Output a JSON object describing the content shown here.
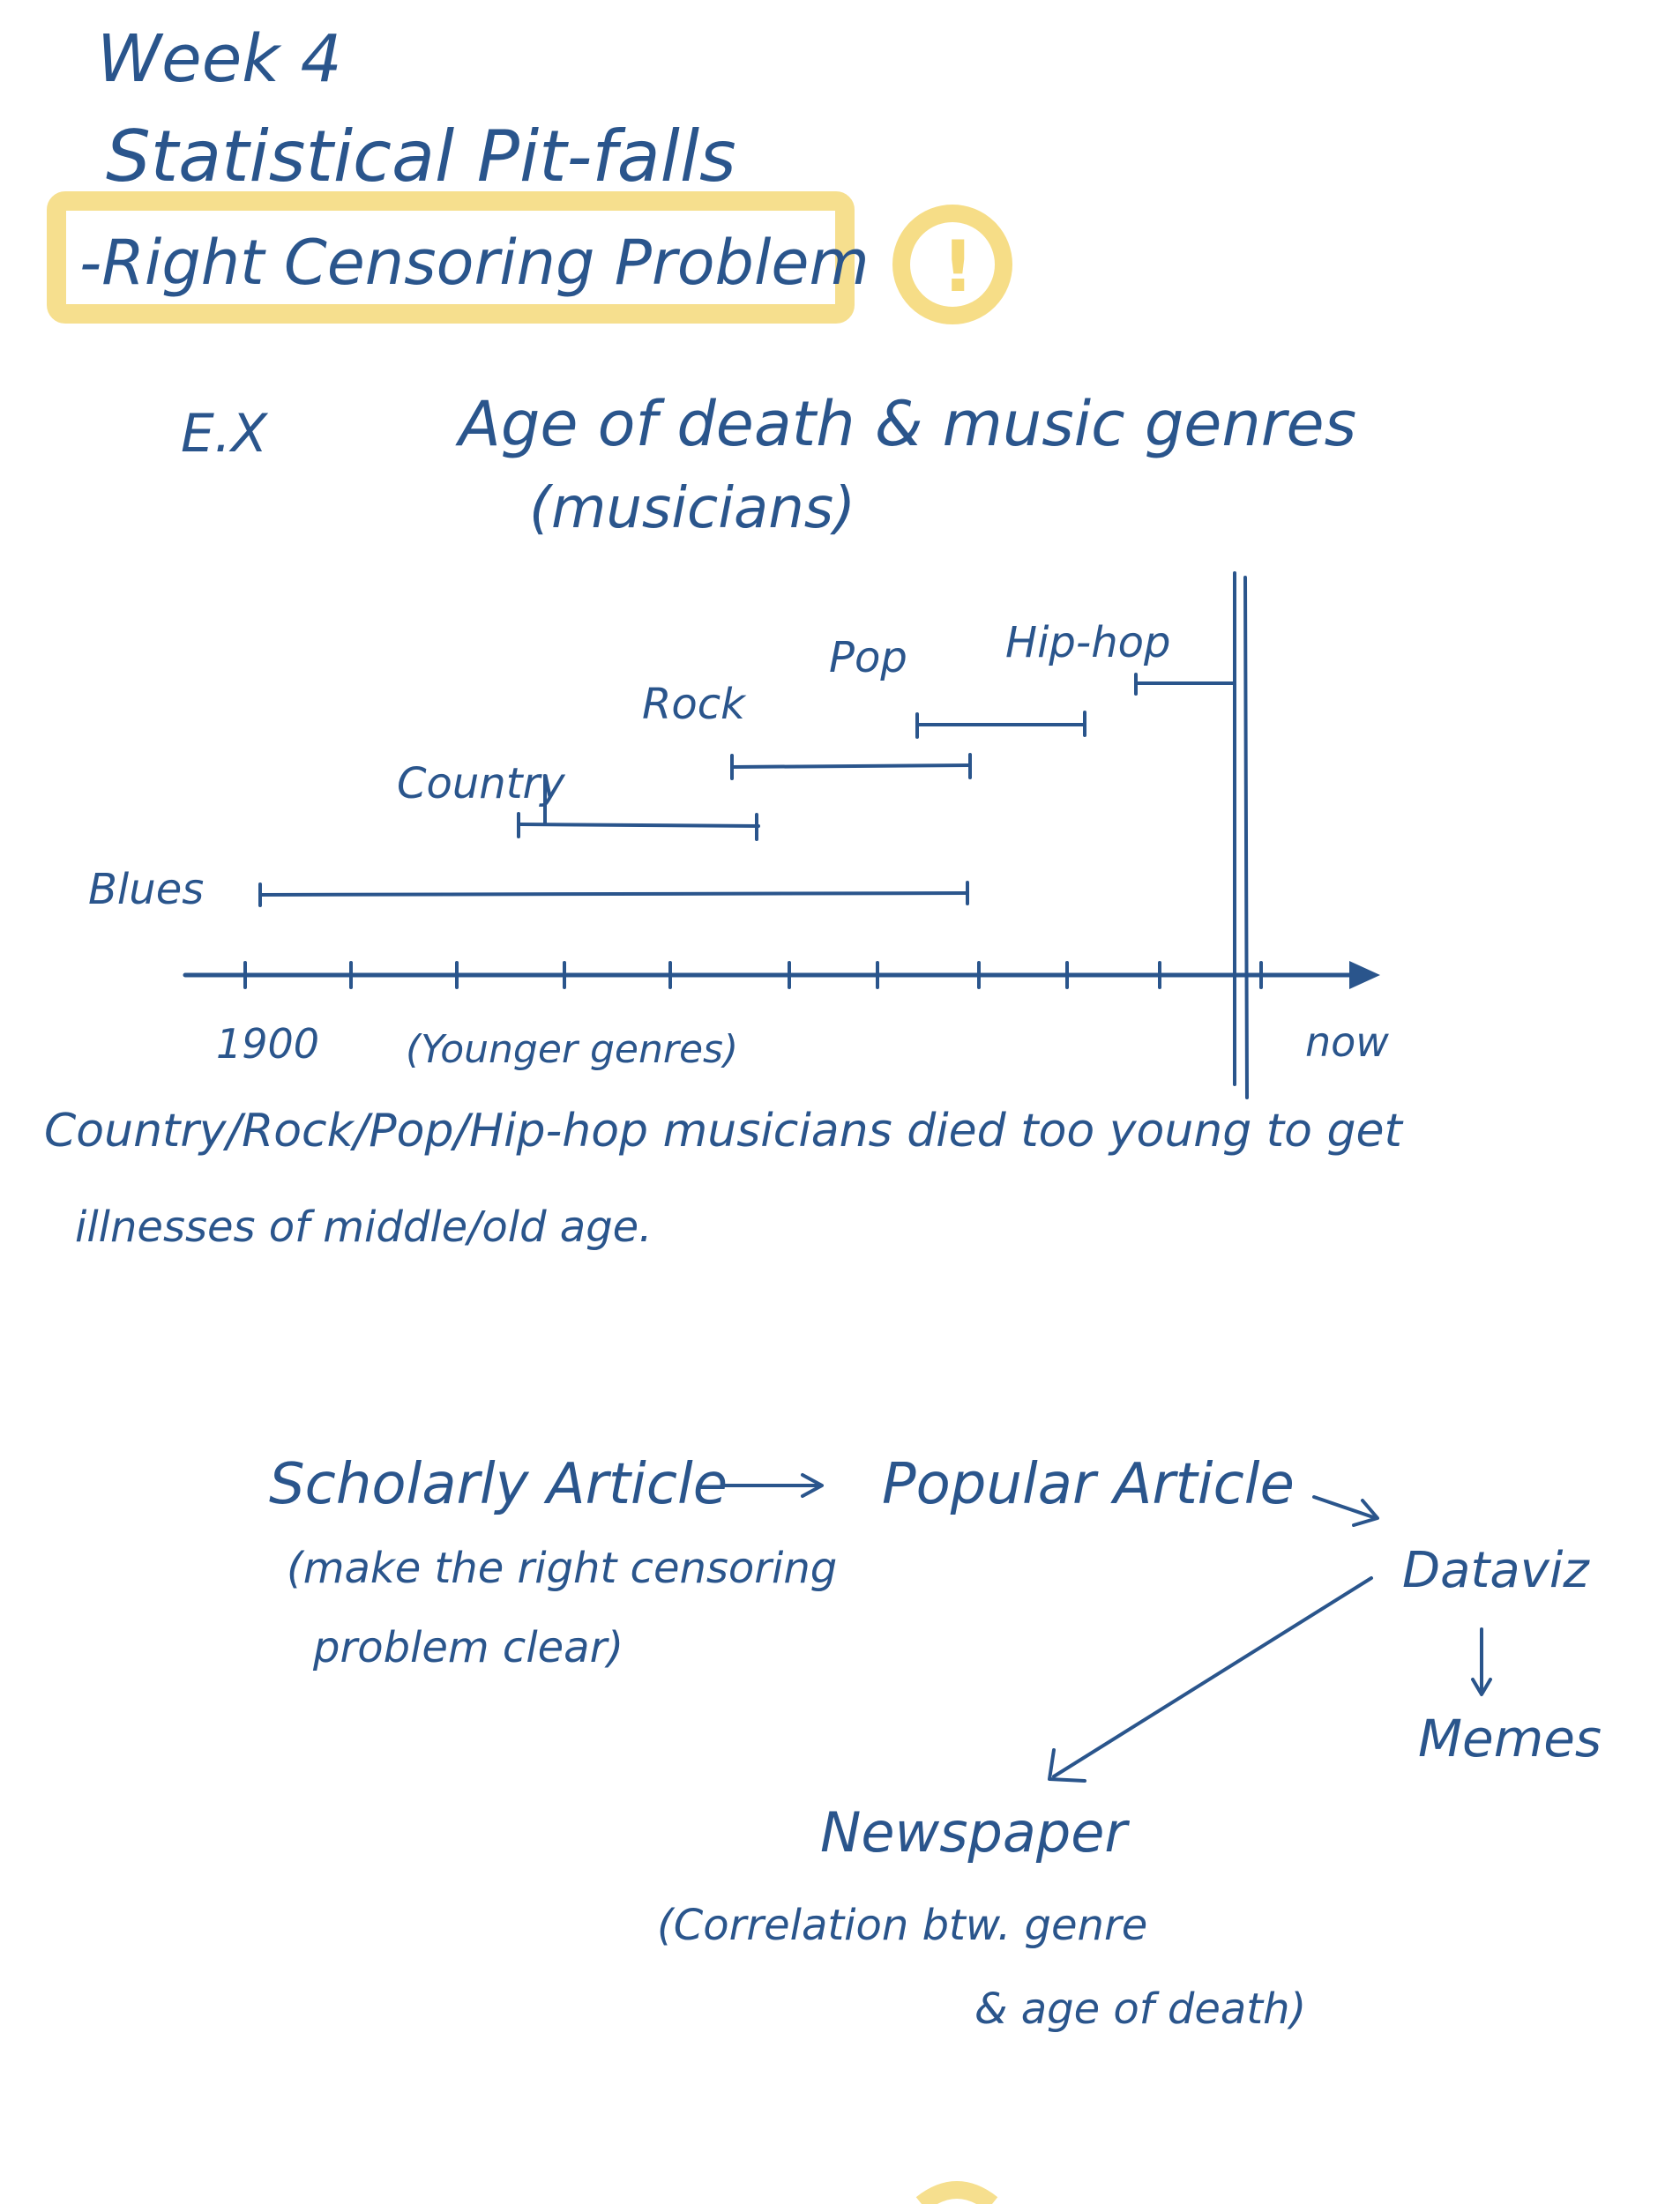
{
  "note": {
    "title_line1": "Week 4",
    "title_line2": "Statistical Pit-falls",
    "topic": "-Right Censoring Problem",
    "topic_badge": "!",
    "example_label": "E.X",
    "example_title": "Age of death & music genres",
    "example_subtitle": "(musicians)"
  },
  "timeline": {
    "genres": [
      "Blues",
      "Country",
      "Rock",
      "Pop",
      "Hip-hop"
    ],
    "start_label": "1900",
    "end_label": "now",
    "younger_label": "(Younger genres)"
  },
  "conclusion": {
    "line1": "Country/Rock/Pop/Hip-hop musicians died too young to get",
    "line2": "illnesses of middle/old age."
  },
  "flow": {
    "scholarly": "Scholarly Article",
    "scholarly_note_line1": "(make the right censoring",
    "scholarly_note_line2": "problem clear)",
    "popular": "Popular Article",
    "dataviz": "Dataviz",
    "memes": "Memes",
    "newspaper": "Newspaper",
    "newspaper_note_line1": "(Correlation btw. genre",
    "newspaper_note_line2": "& age of death)"
  },
  "colors": {
    "ink": "#2a558c",
    "highlight": "#f5d97a"
  }
}
